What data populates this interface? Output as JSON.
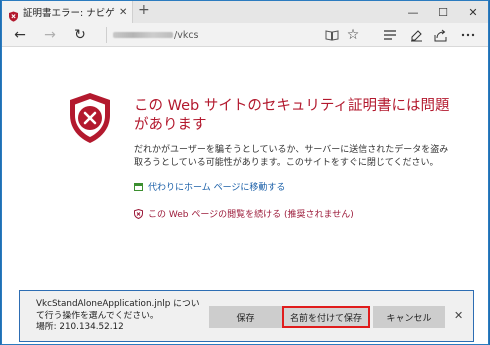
{
  "browser": {
    "tab_title": "証明書エラー: ナビゲーション",
    "tab_close": "✕",
    "new_tab": "+",
    "window_controls": {
      "minimize": "—",
      "maximize": "☐",
      "close": "✕"
    },
    "address_path": "/vkcs",
    "nav_icons": [
      "back-icon",
      "forward-icon",
      "refresh-icon"
    ],
    "toolbar_icons": [
      "reading-view-icon",
      "favorite-star-icon",
      "hub-icon",
      "web-note-icon",
      "share-icon"
    ]
  },
  "page": {
    "heading": "この Web サイトのセキュリティ証明書には問題があります",
    "description": "だれかがユーザーを騙そうとしているか、サーバーに送信されたデータを盗み取ろうとしている可能性があります。このサイトをすぐに閉じてください。",
    "home_link": "代わりにホーム ページに移動する",
    "continue_link": "この Web ページの閲覧を続ける (推奨されません)"
  },
  "download_bar": {
    "message_line1": "VkcStandAloneApplication.jnlp につい",
    "message_line2": "て行う操作を選んでください。",
    "message_line3": "場所: 210.134.52.12",
    "save_label": "保存",
    "save_as_label": "名前を付けて保存",
    "cancel_label": "キャンセル",
    "close": "✕"
  },
  "colors": {
    "accent_red": "#b3192e",
    "link_blue": "#1a5fa8",
    "highlight_border": "#e01c1c"
  }
}
